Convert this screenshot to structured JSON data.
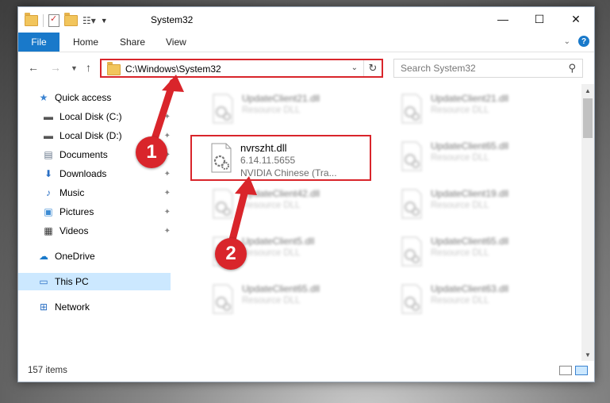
{
  "window": {
    "title": "System32",
    "controls": {
      "minimize": "—",
      "maximize": "☐",
      "close": "✕"
    }
  },
  "ribbon": {
    "tabs": [
      "File",
      "Home",
      "Share",
      "View"
    ],
    "help": "?"
  },
  "address": {
    "path": "C:\\Windows\\System32",
    "search_placeholder": "Search System32"
  },
  "sidebar": {
    "items": [
      {
        "label": "Quick access",
        "icon": "star-icon"
      },
      {
        "label": "Local Disk (C:)",
        "icon": "drive-icon"
      },
      {
        "label": "Local Disk (D:)",
        "icon": "drive-icon"
      },
      {
        "label": "Documents",
        "icon": "documents-icon"
      },
      {
        "label": "Downloads",
        "icon": "download-icon"
      },
      {
        "label": "Music",
        "icon": "music-icon"
      },
      {
        "label": "Pictures",
        "icon": "pictures-icon"
      },
      {
        "label": "Videos",
        "icon": "videos-icon"
      },
      {
        "label": "OneDrive",
        "icon": "cloud-icon"
      },
      {
        "label": "This PC",
        "icon": "computer-icon"
      },
      {
        "label": "Network",
        "icon": "network-icon"
      }
    ]
  },
  "files": {
    "left": [
      {
        "name": "UpdateClient21.dll",
        "sub": "Resource DLL"
      },
      {
        "name": "nvrszht.dll",
        "version": "6.14.11.5655",
        "desc": "NVIDIA Chinese (Tra..."
      },
      {
        "name": "UpdateClient42.dll",
        "sub": "Resource DLL"
      },
      {
        "name": "UpdateClient5.dll",
        "sub": "Resource DLL"
      },
      {
        "name": "UpdateClient65.dll",
        "sub": "Resource DLL"
      }
    ],
    "right": [
      {
        "name": "UpdateClient21.dll",
        "sub": "Resource DLL"
      },
      {
        "name": "UpdateClient65.dll",
        "sub": "Resource DLL"
      },
      {
        "name": "UpdateClient19.dll",
        "sub": "Resource DLL"
      },
      {
        "name": "UpdateClient65.dll",
        "sub": "Resource DLL"
      },
      {
        "name": "UpdateClient63.dll",
        "sub": "Resource DLL"
      }
    ]
  },
  "status": {
    "item_count": "157 items"
  },
  "annotations": {
    "step1": "1",
    "step2": "2",
    "color": "#d9252b"
  }
}
